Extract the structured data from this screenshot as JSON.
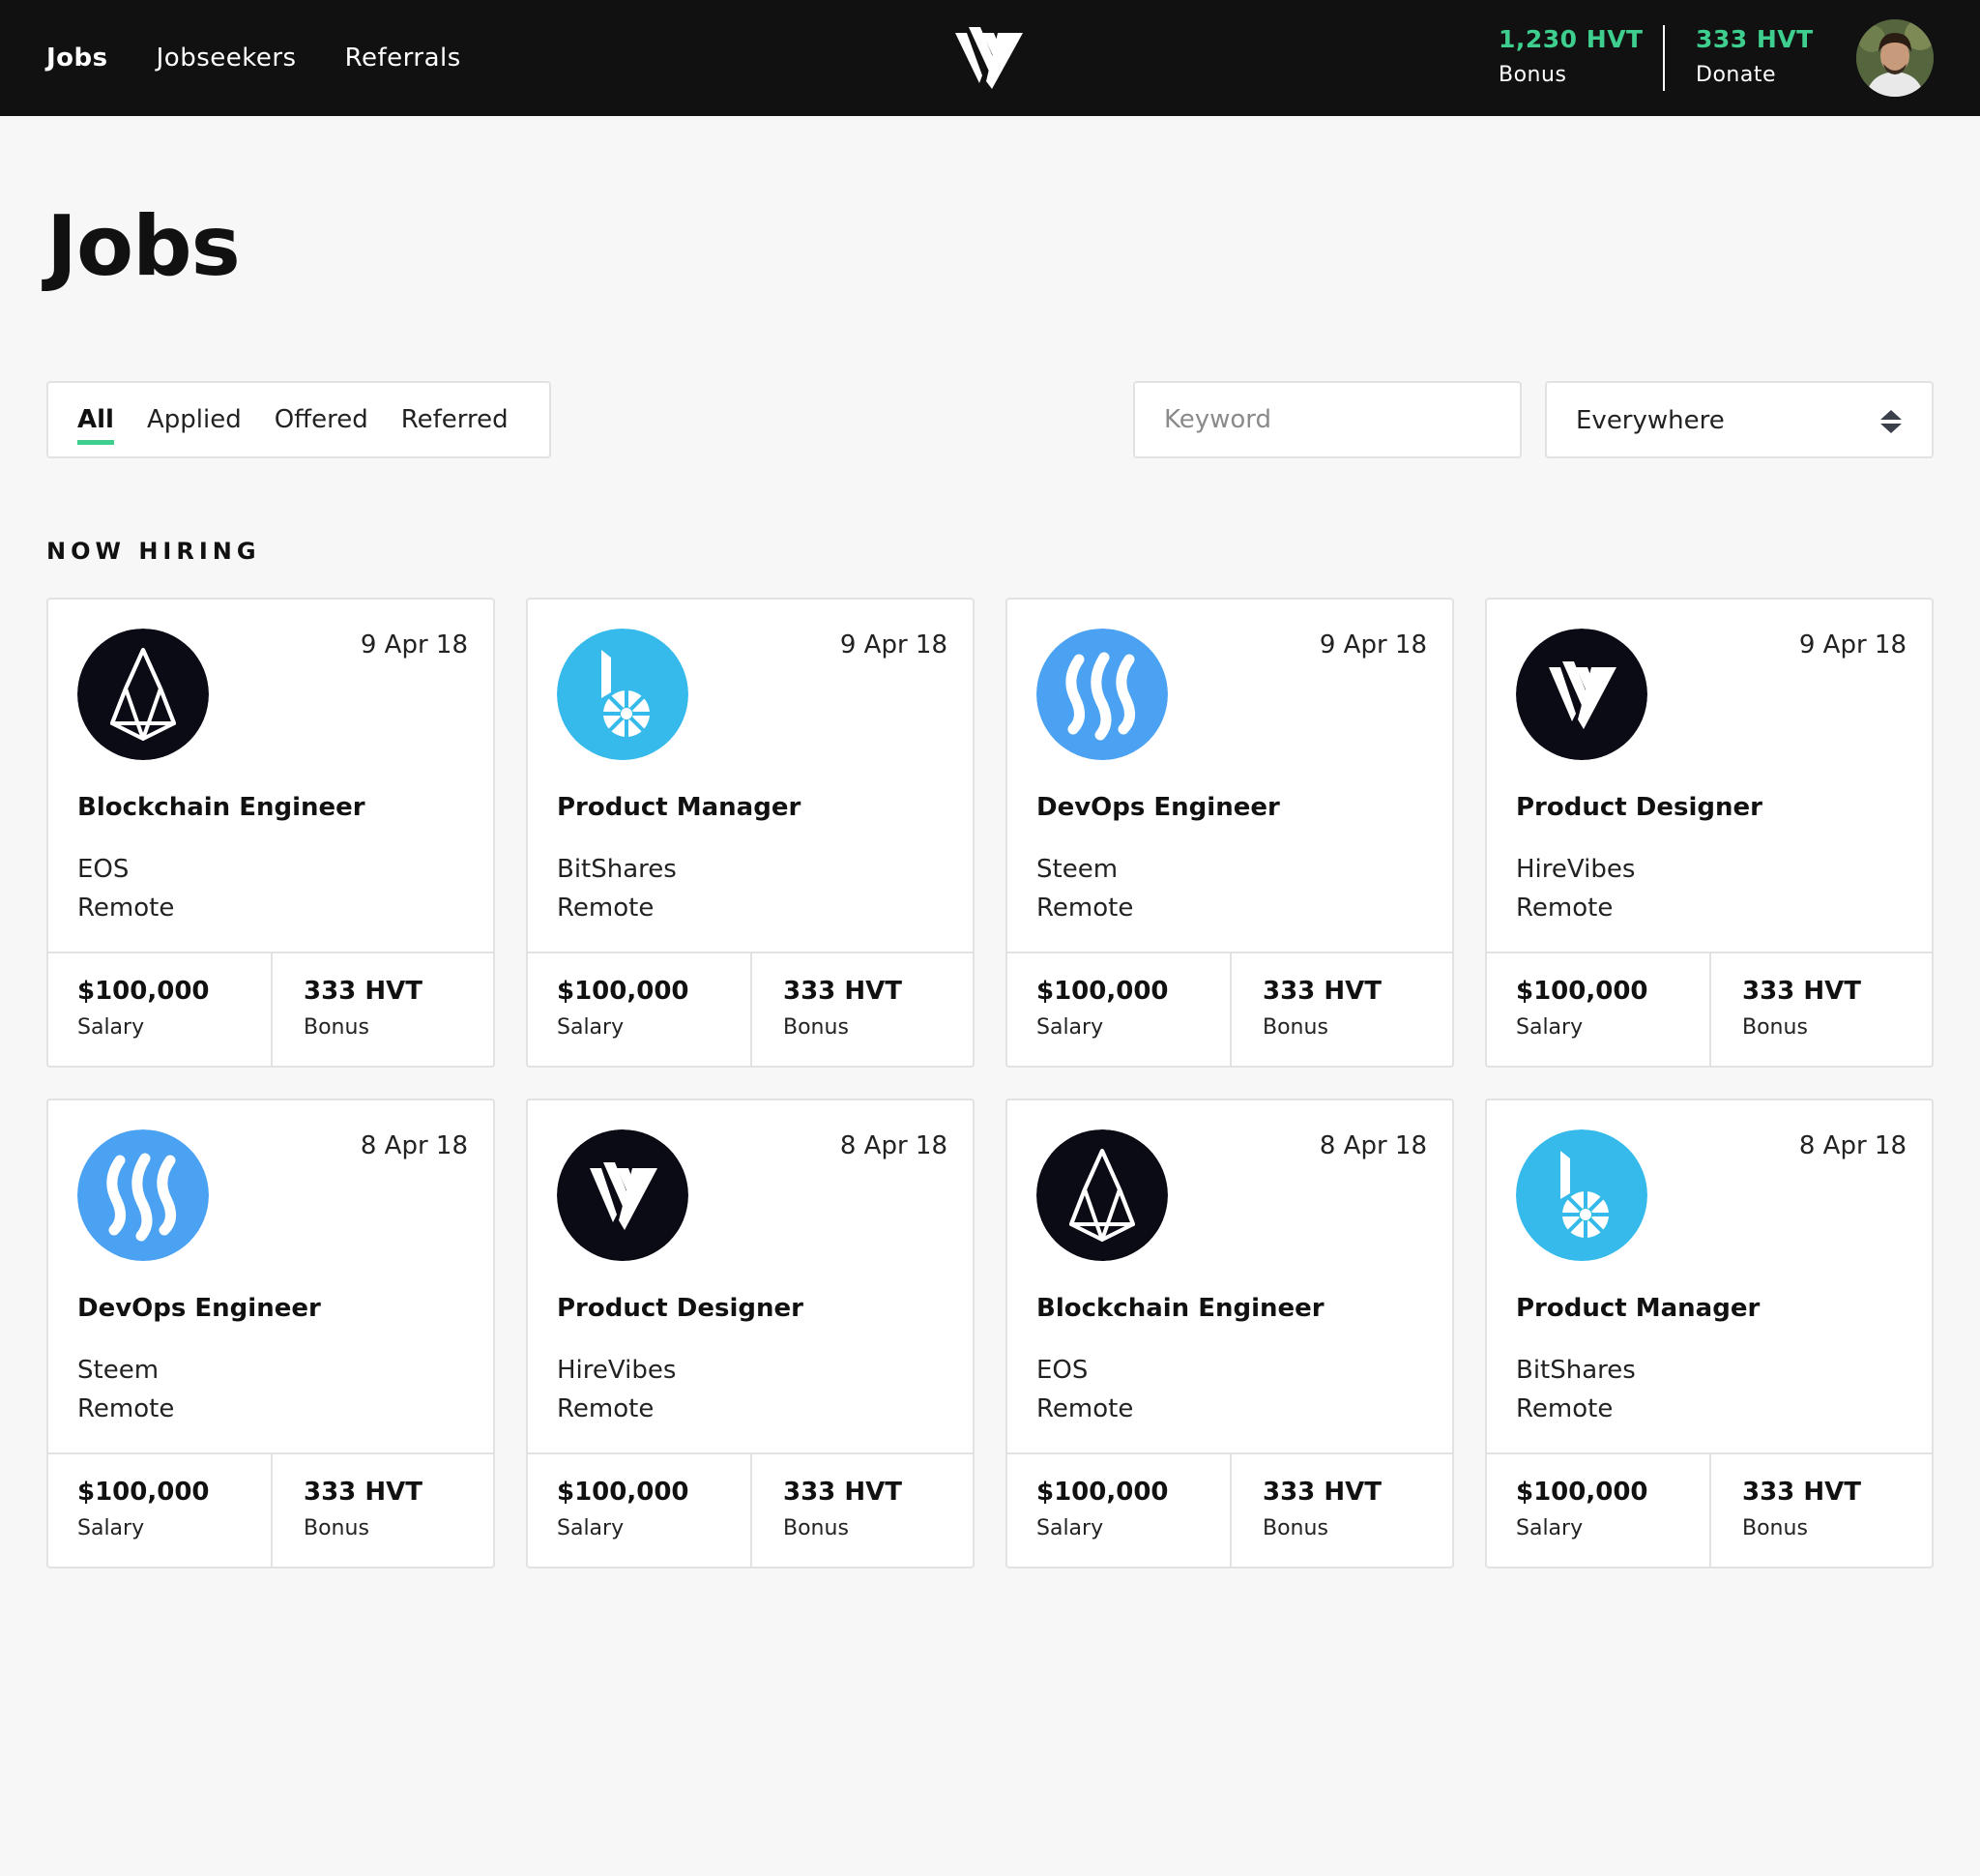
{
  "nav": {
    "items": [
      {
        "label": "Jobs",
        "active": true
      },
      {
        "label": "Jobseekers",
        "active": false
      },
      {
        "label": "Referrals",
        "active": false
      }
    ]
  },
  "stats": {
    "bonus": {
      "value": "1,230 HVT",
      "label": "Bonus"
    },
    "donate": {
      "value": "333 HVT",
      "label": "Donate"
    }
  },
  "colors": {
    "accent": "#3ecf8e",
    "topbar": "#111111",
    "eos": "#0a0b14",
    "bitshares": "#35baeb",
    "steem": "#4ba2f2",
    "hirevibes": "#0a0b14"
  },
  "page": {
    "title": "Jobs"
  },
  "filters": {
    "tabs": [
      {
        "label": "All",
        "active": true
      },
      {
        "label": "Applied",
        "active": false
      },
      {
        "label": "Offered",
        "active": false
      },
      {
        "label": "Referred",
        "active": false
      }
    ],
    "keyword_placeholder": "Keyword",
    "location_value": "Everywhere"
  },
  "section": {
    "title": "NOW HIRING"
  },
  "jobs": [
    {
      "logo": "eos-icon",
      "date": "9 Apr 18",
      "title": "Blockchain Engineer",
      "company": "EOS",
      "location": "Remote",
      "salary": "$100,000",
      "salary_label": "Salary",
      "bonus": "333 HVT",
      "bonus_label": "Bonus"
    },
    {
      "logo": "bitshares-icon",
      "date": "9 Apr 18",
      "title": "Product Manager",
      "company": "BitShares",
      "location": "Remote",
      "salary": "$100,000",
      "salary_label": "Salary",
      "bonus": "333 HVT",
      "bonus_label": "Bonus"
    },
    {
      "logo": "steem-icon",
      "date": "9 Apr 18",
      "title": "DevOps Engineer",
      "company": "Steem",
      "location": "Remote",
      "salary": "$100,000",
      "salary_label": "Salary",
      "bonus": "333 HVT",
      "bonus_label": "Bonus"
    },
    {
      "logo": "hirevibes-icon",
      "date": "9 Apr 18",
      "title": "Product Designer",
      "company": "HireVibes",
      "location": "Remote",
      "salary": "$100,000",
      "salary_label": "Salary",
      "bonus": "333 HVT",
      "bonus_label": "Bonus"
    },
    {
      "logo": "steem-icon",
      "date": "8 Apr 18",
      "title": "DevOps Engineer",
      "company": "Steem",
      "location": "Remote",
      "salary": "$100,000",
      "salary_label": "Salary",
      "bonus": "333 HVT",
      "bonus_label": "Bonus"
    },
    {
      "logo": "hirevibes-icon",
      "date": "8 Apr 18",
      "title": "Product Designer",
      "company": "HireVibes",
      "location": "Remote",
      "salary": "$100,000",
      "salary_label": "Salary",
      "bonus": "333 HVT",
      "bonus_label": "Bonus"
    },
    {
      "logo": "eos-icon",
      "date": "8 Apr 18",
      "title": "Blockchain Engineer",
      "company": "EOS",
      "location": "Remote",
      "salary": "$100,000",
      "salary_label": "Salary",
      "bonus": "333 HVT",
      "bonus_label": "Bonus"
    },
    {
      "logo": "bitshares-icon",
      "date": "8 Apr 18",
      "title": "Product Manager",
      "company": "BitShares",
      "location": "Remote",
      "salary": "$100,000",
      "salary_label": "Salary",
      "bonus": "333 HVT",
      "bonus_label": "Bonus"
    }
  ]
}
